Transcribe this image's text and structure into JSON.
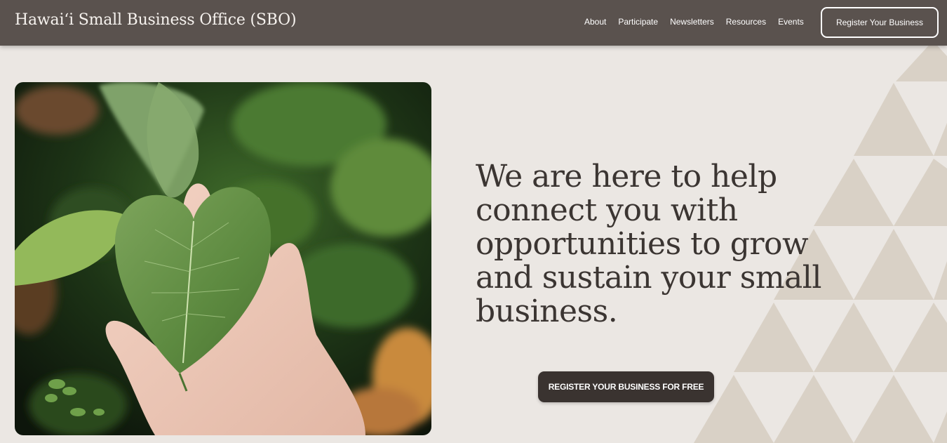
{
  "header": {
    "site_title": "Hawaiʻi Small Business Office (SBO)",
    "nav": [
      {
        "label": "About"
      },
      {
        "label": "Participate"
      },
      {
        "label": "Newsletters"
      },
      {
        "label": "Resources"
      },
      {
        "label": "Events"
      }
    ],
    "cta_label": "Register Your Business"
  },
  "hero": {
    "image_icon": "heart-shaped-leaf-in-hand-photo",
    "headline": "We are here to help connect you with opportunities to grow and sustain your small business.",
    "cta_label": "REGISTER YOUR BUSINESS FOR FREE"
  },
  "colors": {
    "header_bg": "#5a524e",
    "page_bg": "#ebe7e3",
    "pattern": "#d9d1c6",
    "button_dark": "#3a3330",
    "headline_text": "#3b3532"
  }
}
